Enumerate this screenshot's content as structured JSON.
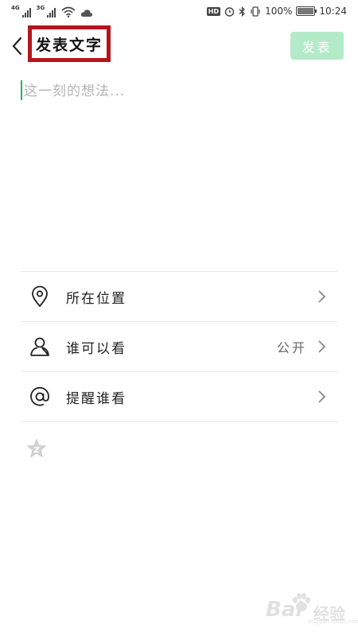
{
  "status_bar": {
    "network_1": "4G",
    "network_2": "3G",
    "hd_badge": "HD",
    "battery_percent": "100%",
    "time": "10:24"
  },
  "header": {
    "title": "发表文字",
    "publish_label": "发表"
  },
  "editor": {
    "placeholder": "这一刻的想法..."
  },
  "options": [
    {
      "label": "所在位置",
      "value": "",
      "icon": "location-pin-icon"
    },
    {
      "label": "谁可以看",
      "value": "公开",
      "icon": "person-icon"
    },
    {
      "label": "提醒谁看",
      "value": "",
      "icon": "at-sign-icon"
    }
  ],
  "extra": {
    "icon": "star-icon"
  },
  "watermark": {
    "brand": "Bai",
    "brand_cn": "经验",
    "url": "jingyan.baidu.com"
  },
  "colors": {
    "accent_green": "#20b26b",
    "publish_disabled": "#b3ebc8",
    "highlight_red": "#b3161b"
  }
}
